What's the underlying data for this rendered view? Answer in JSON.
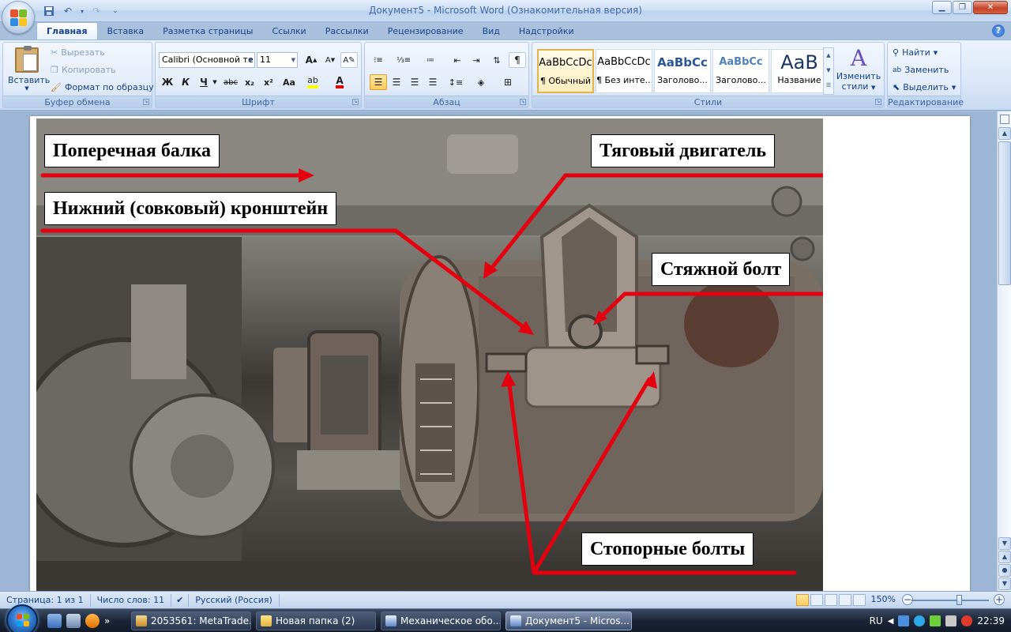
{
  "window": {
    "title": "Документ5 - Microsoft Word (Ознакомительная версия)"
  },
  "qat": {
    "undo_arrow": "▾"
  },
  "tabs": [
    {
      "label": "Главная"
    },
    {
      "label": "Вставка"
    },
    {
      "label": "Разметка страницы"
    },
    {
      "label": "Ссылки"
    },
    {
      "label": "Рассылки"
    },
    {
      "label": "Рецензирование"
    },
    {
      "label": "Вид"
    },
    {
      "label": "Надстройки"
    }
  ],
  "ribbon": {
    "clipboard": {
      "label": "Буфер обмена",
      "paste": "Вставить",
      "cut": "Вырезать",
      "copy": "Копировать",
      "format_painter": "Формат по образцу"
    },
    "font": {
      "label": "Шрифт",
      "font_name": "Calibri (Основной те",
      "font_size": "11",
      "bold": "Ж",
      "italic": "К",
      "underline": "Ч",
      "strike": "abc",
      "subscript": "x₂",
      "superscript": "x²",
      "change_case": "Aa",
      "grow": "A",
      "shrink": "A"
    },
    "paragraph": {
      "label": "Абзац",
      "pilcrow": "¶"
    },
    "styles": {
      "label": "Стили",
      "items": [
        {
          "sample": "AaBbCcDc",
          "name": "¶ Обычный"
        },
        {
          "sample": "AaBbCcDc",
          "name": "¶ Без инте..."
        },
        {
          "sample": "AaBbCc",
          "name": "Заголово..."
        },
        {
          "sample": "AaBbCc",
          "name": "Заголово..."
        },
        {
          "sample": "AaB",
          "name": "Название"
        }
      ],
      "change_styles_line1": "Изменить",
      "change_styles_line2": "стили"
    },
    "editing": {
      "label": "Редактирование",
      "find": "Найти",
      "replace": "Заменить",
      "select": "Выделить"
    }
  },
  "document": {
    "callouts": {
      "cross_beam": "Поперечная балка",
      "traction_motor": "Тяговый двигатель",
      "lower_bracket": "Нижний (совковый) кронштейн",
      "tie_bolt": "Стяжной болт",
      "lock_bolts": "Стопорные болты"
    }
  },
  "statusbar": {
    "page": "Страница: 1 из 1",
    "words": "Число слов: 11",
    "language": "Русский (Россия)",
    "zoom": "150%"
  },
  "taskbar": {
    "tasks": [
      {
        "label": "2053561: MetaTrade..."
      },
      {
        "label": "Новая папка (2)"
      },
      {
        "label": "Механическое обо..."
      },
      {
        "label": "Документ5 - Micros..."
      }
    ],
    "lang": "RU",
    "clock": "22:39"
  },
  "colors": {
    "arrow_red": "#e4000f",
    "ribbon_text": "#15428b"
  }
}
